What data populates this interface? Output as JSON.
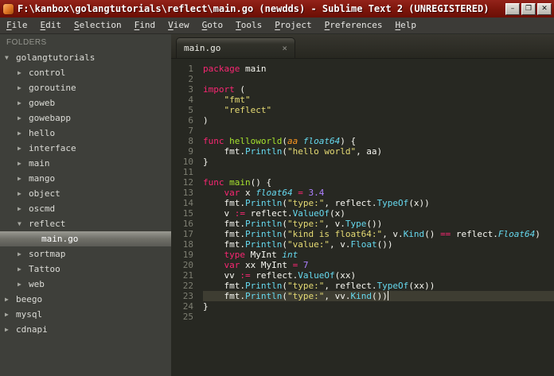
{
  "window": {
    "title": "F:\\kanbox\\golangtutorials\\reflect\\main.go (newdds) - Sublime Text 2 (UNREGISTERED)",
    "controls": {
      "minimize": "–",
      "maximize": "❐",
      "close": "✕"
    }
  },
  "menu_bar": {
    "items": [
      {
        "label": "File",
        "u": 0
      },
      {
        "label": "Edit",
        "u": 0
      },
      {
        "label": "Selection",
        "u": 0
      },
      {
        "label": "Find",
        "u": 0
      },
      {
        "label": "View",
        "u": 0
      },
      {
        "label": "Goto",
        "u": 0
      },
      {
        "label": "Tools",
        "u": 0
      },
      {
        "label": "Project",
        "u": 0
      },
      {
        "label": "Preferences",
        "u": 0
      },
      {
        "label": "Help",
        "u": 0
      }
    ]
  },
  "sidebar": {
    "header": "FOLDERS",
    "items": [
      {
        "label": "golangtutorials",
        "indent": 0,
        "type": "folder",
        "expanded": true
      },
      {
        "label": "control",
        "indent": 1,
        "type": "folder",
        "expanded": false
      },
      {
        "label": "goroutine",
        "indent": 1,
        "type": "folder",
        "expanded": false
      },
      {
        "label": "goweb",
        "indent": 1,
        "type": "folder",
        "expanded": false
      },
      {
        "label": "gowebapp",
        "indent": 1,
        "type": "folder",
        "expanded": false
      },
      {
        "label": "hello",
        "indent": 1,
        "type": "folder",
        "expanded": false
      },
      {
        "label": "interface",
        "indent": 1,
        "type": "folder",
        "expanded": false
      },
      {
        "label": "main",
        "indent": 1,
        "type": "folder",
        "expanded": false
      },
      {
        "label": "mango",
        "indent": 1,
        "type": "folder",
        "expanded": false
      },
      {
        "label": "object",
        "indent": 1,
        "type": "folder",
        "expanded": false
      },
      {
        "label": "oscmd",
        "indent": 1,
        "type": "folder",
        "expanded": false
      },
      {
        "label": "reflect",
        "indent": 1,
        "type": "folder",
        "expanded": true
      },
      {
        "label": "main.go",
        "indent": 2,
        "type": "file",
        "selected": true
      },
      {
        "label": "sortmap",
        "indent": 1,
        "type": "folder",
        "expanded": false
      },
      {
        "label": "Tattoo",
        "indent": 1,
        "type": "folder",
        "expanded": false
      },
      {
        "label": "web",
        "indent": 1,
        "type": "folder",
        "expanded": false
      },
      {
        "label": "beego",
        "indent": 0,
        "type": "folder",
        "expanded": false
      },
      {
        "label": "mysql",
        "indent": 0,
        "type": "folder",
        "expanded": false
      },
      {
        "label": "cdnapi",
        "indent": 0,
        "type": "folder",
        "expanded": false
      }
    ]
  },
  "tabs": [
    {
      "label": "main.go",
      "active": true,
      "close": "×"
    }
  ],
  "editor": {
    "active_line": 23,
    "lines": [
      [
        [
          "k",
          "package"
        ],
        [
          "p",
          " main"
        ]
      ],
      [],
      [
        [
          "k",
          "import"
        ],
        [
          "p",
          " ("
        ]
      ],
      [
        [
          "p",
          "    "
        ],
        [
          "s",
          "\"fmt\""
        ]
      ],
      [
        [
          "p",
          "    "
        ],
        [
          "s",
          "\"reflect\""
        ]
      ],
      [
        [
          "p",
          ")"
        ]
      ],
      [],
      [
        [
          "k",
          "func"
        ],
        [
          "p",
          " "
        ],
        [
          "f",
          "helloworld"
        ],
        [
          "p",
          "("
        ],
        [
          "a",
          "aa"
        ],
        [
          "p",
          " "
        ],
        [
          "t",
          "float64"
        ],
        [
          "p",
          ") {"
        ]
      ],
      [
        [
          "p",
          "    fmt."
        ],
        [
          "c",
          "Println"
        ],
        [
          "p",
          "("
        ],
        [
          "s",
          "\"hello world\""
        ],
        [
          "p",
          ", aa)"
        ]
      ],
      [
        [
          "p",
          "}"
        ]
      ],
      [],
      [
        [
          "k",
          "func"
        ],
        [
          "p",
          " "
        ],
        [
          "f",
          "main"
        ],
        [
          "p",
          "() {"
        ]
      ],
      [
        [
          "p",
          "    "
        ],
        [
          "k",
          "var"
        ],
        [
          "p",
          " x "
        ],
        [
          "t",
          "float64"
        ],
        [
          "p",
          " "
        ],
        [
          "o",
          "="
        ],
        [
          "p",
          " "
        ],
        [
          "n",
          "3.4"
        ]
      ],
      [
        [
          "p",
          "    fmt."
        ],
        [
          "c",
          "Println"
        ],
        [
          "p",
          "("
        ],
        [
          "s",
          "\"type:\""
        ],
        [
          "p",
          ", reflect."
        ],
        [
          "c",
          "TypeOf"
        ],
        [
          "p",
          "(x))"
        ]
      ],
      [
        [
          "p",
          "    v "
        ],
        [
          "o",
          ":="
        ],
        [
          "p",
          " reflect."
        ],
        [
          "c",
          "ValueOf"
        ],
        [
          "p",
          "(x)"
        ]
      ],
      [
        [
          "p",
          "    fmt."
        ],
        [
          "c",
          "Println"
        ],
        [
          "p",
          "("
        ],
        [
          "s",
          "\"type:\""
        ],
        [
          "p",
          ", v."
        ],
        [
          "c",
          "Type"
        ],
        [
          "p",
          "())"
        ]
      ],
      [
        [
          "p",
          "    fmt."
        ],
        [
          "c",
          "Println"
        ],
        [
          "p",
          "("
        ],
        [
          "s",
          "\"kind is float64:\""
        ],
        [
          "p",
          ", v."
        ],
        [
          "c",
          "Kind"
        ],
        [
          "p",
          "() "
        ],
        [
          "o",
          "=="
        ],
        [
          "p",
          " reflect."
        ],
        [
          "t",
          "Float64"
        ],
        [
          "p",
          ")"
        ]
      ],
      [
        [
          "p",
          "    fmt."
        ],
        [
          "c",
          "Println"
        ],
        [
          "p",
          "("
        ],
        [
          "s",
          "\"value:\""
        ],
        [
          "p",
          ", v."
        ],
        [
          "c",
          "Float"
        ],
        [
          "p",
          "())"
        ]
      ],
      [
        [
          "p",
          "    "
        ],
        [
          "k",
          "type"
        ],
        [
          "p",
          " MyInt "
        ],
        [
          "t",
          "int"
        ]
      ],
      [
        [
          "p",
          "    "
        ],
        [
          "k",
          "var"
        ],
        [
          "p",
          " xx MyInt "
        ],
        [
          "o",
          "="
        ],
        [
          "p",
          " "
        ],
        [
          "n",
          "7"
        ]
      ],
      [
        [
          "p",
          "    vv "
        ],
        [
          "o",
          ":="
        ],
        [
          "p",
          " reflect."
        ],
        [
          "c",
          "ValueOf"
        ],
        [
          "p",
          "(xx)"
        ]
      ],
      [
        [
          "p",
          "    fmt."
        ],
        [
          "c",
          "Println"
        ],
        [
          "p",
          "("
        ],
        [
          "s",
          "\"type:\""
        ],
        [
          "p",
          ", reflect."
        ],
        [
          "c",
          "TypeOf"
        ],
        [
          "p",
          "(xx))"
        ]
      ],
      [
        [
          "p",
          "    fmt."
        ],
        [
          "c",
          "Println"
        ],
        [
          "p",
          "("
        ],
        [
          "s",
          "\"type:\""
        ],
        [
          "p",
          ", vv."
        ],
        [
          "c",
          "Kind"
        ],
        [
          "p",
          "())"
        ]
      ],
      [
        [
          "p",
          "}"
        ]
      ],
      []
    ]
  },
  "colors": {
    "editor_background": "#272822",
    "sidebar_background": "#3e3f3a",
    "titlebar_background": "#7c150b",
    "active_line": "#3e3d32",
    "keyword": "#f92672",
    "string": "#e6db74",
    "number": "#ae81ff",
    "type": "#66d9ef",
    "function_name": "#a6e22e",
    "parameter": "#fd971f",
    "text": "#f8f8f2"
  }
}
